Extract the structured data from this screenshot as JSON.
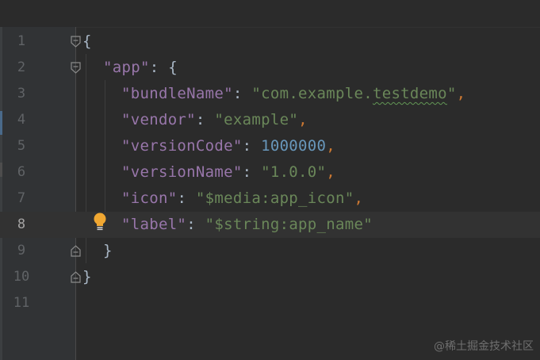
{
  "editor": {
    "lines": [
      {
        "number": "1"
      },
      {
        "number": "2"
      },
      {
        "number": "3"
      },
      {
        "number": "4"
      },
      {
        "number": "5"
      },
      {
        "number": "6"
      },
      {
        "number": "7"
      },
      {
        "number": "8"
      },
      {
        "number": "9"
      },
      {
        "number": "10"
      },
      {
        "number": "11"
      }
    ],
    "code": {
      "l1_brace": "{",
      "l2_key": "\"app\"",
      "l2_colon": ": ",
      "l2_brace": "{",
      "l3_key": "\"bundleName\"",
      "l3_colon": ": ",
      "l3_value_a": "\"com.example.",
      "l3_value_b": "testdemo",
      "l3_value_c": "\"",
      "l3_comma": ",",
      "l4_key": "\"vendor\"",
      "l4_colon": ": ",
      "l4_value": "\"example\"",
      "l4_comma": ",",
      "l5_key": "\"versionCode\"",
      "l5_colon": ": ",
      "l5_value": "1000000",
      "l5_comma": ",",
      "l6_key": "\"versionName\"",
      "l6_colon": ": ",
      "l6_value": "\"1.0.0\"",
      "l6_comma": ",",
      "l7_key": "\"icon\"",
      "l7_colon": ": ",
      "l7_value": "\"$media:app_icon\"",
      "l7_comma": ",",
      "l8_key": "\"label\"",
      "l8_colon": ": ",
      "l8_value": "\"$string:app_name\"",
      "l9_brace": "}",
      "l10_brace": "}"
    },
    "current_line": "8"
  },
  "watermark": "@稀土掘金技术社区",
  "icons": {
    "fold": "fold-marker-icon",
    "bulb": "lightbulb-icon"
  },
  "colors": {
    "background": "#2b2b2b",
    "gutter": "#313335",
    "key": "#9876aa",
    "string": "#6a8759",
    "number": "#6897bb",
    "punctuation": "#cc7832",
    "bulb": "#f0a732"
  }
}
